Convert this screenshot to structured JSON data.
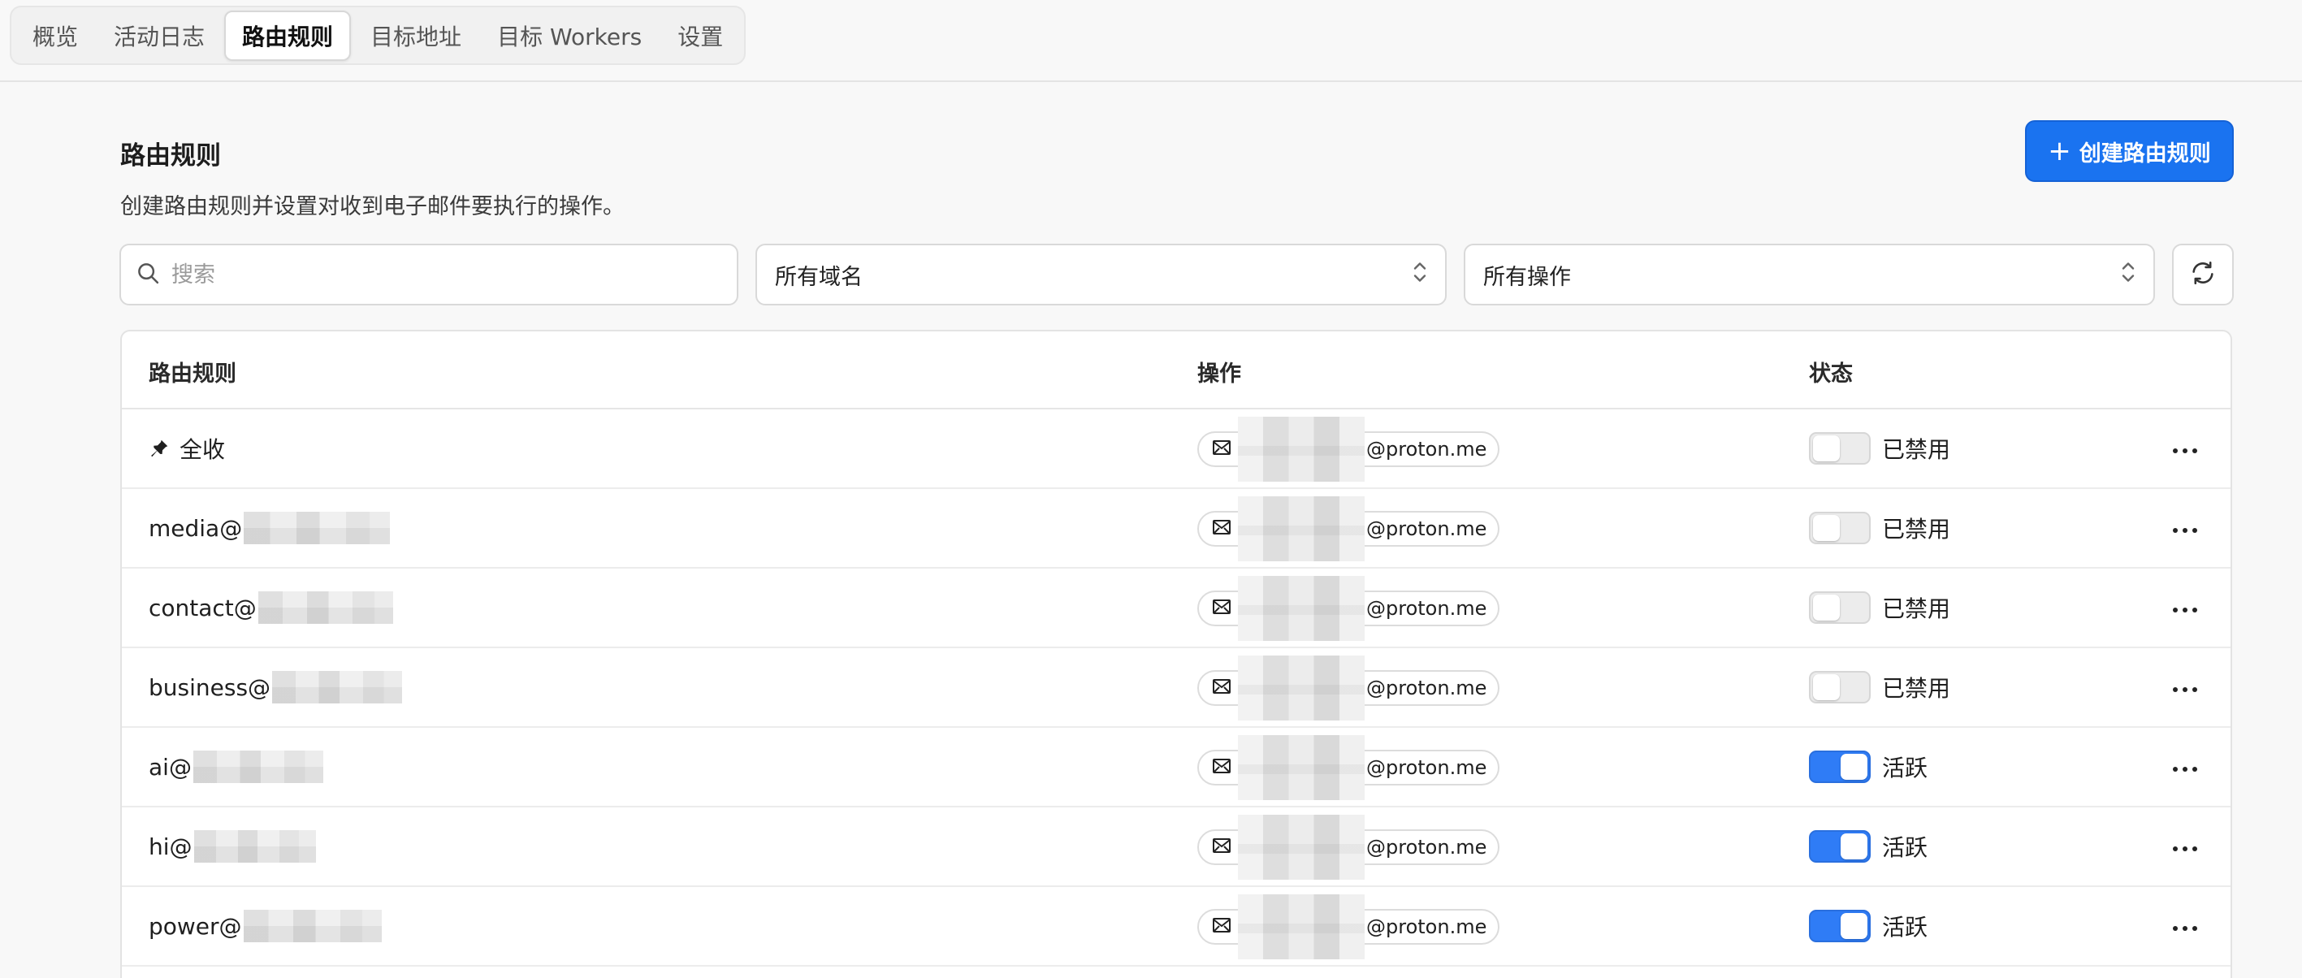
{
  "nav": {
    "tabs": [
      {
        "label": "概览",
        "active": false
      },
      {
        "label": "活动日志",
        "active": false
      },
      {
        "label": "路由规则",
        "active": true
      },
      {
        "label": "目标地址",
        "active": false
      },
      {
        "label": "目标 Workers",
        "active": false
      },
      {
        "label": "设置",
        "active": false
      }
    ]
  },
  "header": {
    "title": "路由规则",
    "description": "创建路由规则并设置对收到电子邮件要执行的操作。",
    "create_button": "创建路由规则"
  },
  "filters": {
    "search_placeholder": "搜索",
    "domain_select": "所有域名",
    "action_select": "所有操作"
  },
  "table": {
    "columns": [
      "路由规则",
      "操作",
      "状态"
    ],
    "rows": [
      {
        "rule": "全收",
        "pinned": true,
        "target_suffix": "@proton.me",
        "status": "已禁用",
        "enabled": false
      },
      {
        "rule": "media@",
        "pinned": false,
        "target_suffix": "@proton.me",
        "status": "已禁用",
        "enabled": false
      },
      {
        "rule": "contact@",
        "pinned": false,
        "target_suffix": "@proton.me",
        "status": "已禁用",
        "enabled": false
      },
      {
        "rule": "business@",
        "pinned": false,
        "target_suffix": "@proton.me",
        "status": "已禁用",
        "enabled": false
      },
      {
        "rule": "ai@",
        "pinned": false,
        "target_suffix": "@proton.me",
        "status": "活跃",
        "enabled": true
      },
      {
        "rule": "hi@",
        "pinned": false,
        "target_suffix": "@proton.me",
        "status": "活跃",
        "enabled": true
      },
      {
        "rule": "power@",
        "pinned": false,
        "target_suffix": "@proton.me",
        "status": "活跃",
        "enabled": true
      }
    ]
  },
  "colors": {
    "accent": "#1a73f0",
    "toggle_on": "#2f7cf6",
    "toggle_off": "#ececec"
  }
}
